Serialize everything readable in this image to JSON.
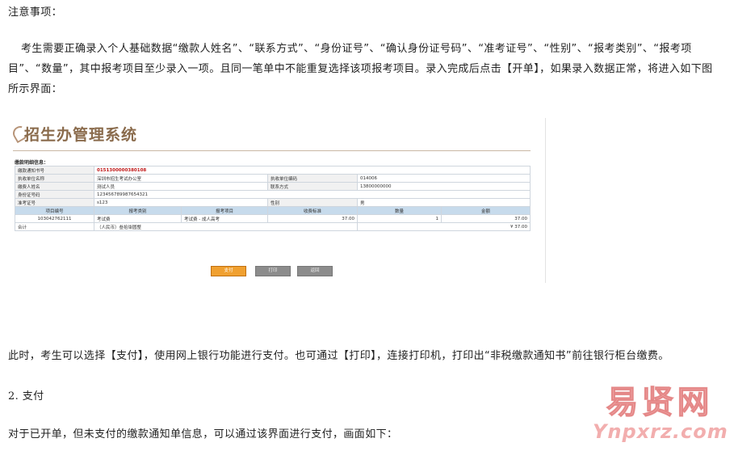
{
  "notes_title": "注意事项：",
  "intro_paragraph": "考生需要正确录入个人基础数据“缴款人姓名”、“联系方式”、“身份证号”、“确认身份证号码”、“准考证号”、“性别”、“报考类别”、“报考项目”、“数量”，其中报考项目至少录入一项。且同一笔单中不能重复选择该项报考项目。录入完成后点击【开单】，如果录入数据正常，将进入如下图所示界面：",
  "screenshot": {
    "brand": "招生办管理系统",
    "panel_title": "缴款明细信息：",
    "rows": [
      {
        "label1": "缴款通知书号",
        "value1": "0151300000380108"
      },
      {
        "label1": "执收单位名称",
        "value1": "深圳市招生考试办公室",
        "label2": "执收单位编码",
        "value2": "014006"
      },
      {
        "label1": "缴费人姓名",
        "value1": "测试人员",
        "label2": "联系方式",
        "value2": "13800000000"
      },
      {
        "label1": "身份证号码",
        "value1": "123456789987654321"
      },
      {
        "label1": "准考证号",
        "value1": "s123",
        "label2": "性别",
        "value2": "男"
      }
    ],
    "item_headers": [
      "项目编号",
      "报考类别",
      "报考项目",
      "收费标准",
      "数量",
      "金额"
    ],
    "item_row": {
      "code": "103042762111",
      "category": "考试费",
      "project": "考试费 - 成人高考",
      "price": "37.00",
      "qty": "1",
      "amount": "37.00"
    },
    "total_label": "合计",
    "total_words": "（人民币）叁拾柒圆整",
    "total_amount": "¥ 37.00",
    "buttons": {
      "pay": "支付",
      "print": "打印",
      "back": "返回"
    }
  },
  "after_paragraph": "此时，考生可以选择【支付】，使用网上银行功能进行支付。也可通过【打印】，连接打印机，打印出“非税缴款通知书”前往银行柜台缴费。",
  "section_heading": "2. 支付",
  "last_paragraph": "对于已开单，但未支付的缴款通知单信息，可以通过该界面进行支付，画面如下：",
  "watermark": {
    "cn": "易贤网",
    "en": "Ynpxrz.com"
  }
}
